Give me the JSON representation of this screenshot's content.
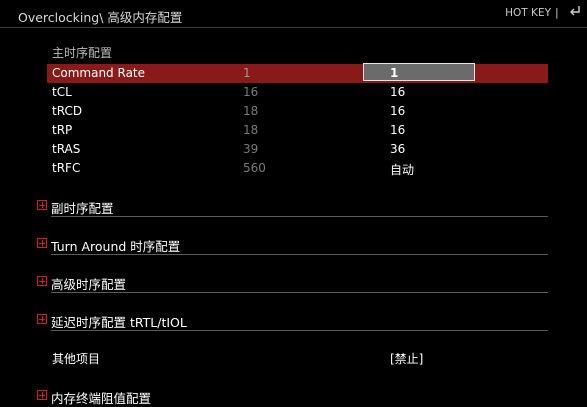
{
  "header": {
    "title": "Overclocking\\ 高级内存配置",
    "hotkey": "HOT KEY",
    "separator": "|"
  },
  "main_timing": {
    "title": "主时序配置",
    "rows": [
      {
        "name": "Command Rate",
        "current": "1",
        "value": "1"
      },
      {
        "name": "tCL",
        "current": "16",
        "value": "16"
      },
      {
        "name": "tRCD",
        "current": "18",
        "value": "16"
      },
      {
        "name": "tRP",
        "current": "18",
        "value": "16"
      },
      {
        "name": "tRAS",
        "current": "39",
        "value": "36"
      },
      {
        "name": "tRFC",
        "current": "560",
        "value": "自动"
      }
    ]
  },
  "sections": [
    {
      "label": "副时序配置"
    },
    {
      "label": "Turn Around 时序配置"
    },
    {
      "label": "高级时序配置"
    },
    {
      "label": "延迟时序配置 tRTL/tIOL"
    }
  ],
  "other": {
    "label": "其他项目",
    "value": "[禁止]"
  },
  "last_section": {
    "label": "内存终端阻值配置"
  },
  "colors": {
    "selected_row": "#8a1a1a",
    "expand_icon": "#d02020",
    "background": "#000000"
  }
}
